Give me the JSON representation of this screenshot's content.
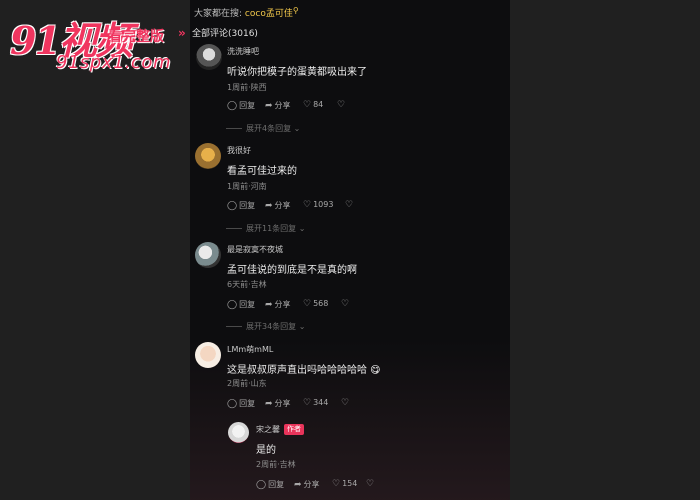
{
  "watermark": {
    "brand": "91视频",
    "see_full": "看完整版",
    "arrows": "»",
    "site": "91spx1.com"
  },
  "header": {
    "search_prefix": "大家都在搜:",
    "search_term": "coco孟可佳",
    "search_icon": "search-icon",
    "total_comments": "全部评论(3016)"
  },
  "comments": [
    {
      "user": "洗洗睡吧",
      "text": "听说你把模子的蛋黄都吸出来了",
      "meta": "1周前·陕西",
      "reply": "回复",
      "share": "分享",
      "likes": "84",
      "expand": "展开4条回复"
    },
    {
      "user": "我很好",
      "text": "看孟可佳过来的",
      "meta": "1周前·河南",
      "reply": "回复",
      "share": "分享",
      "likes": "1093",
      "expand": "展开11条回复"
    },
    {
      "user": "最是寂寞不夜城",
      "text": "孟可佳说的到底是不是真的啊",
      "meta": "6天前·吉林",
      "reply": "回复",
      "share": "分享",
      "likes": "568",
      "expand": "展开34条回复"
    },
    {
      "user": "LMm萌mML",
      "text": "这是叔叔原声直出吗哈哈哈哈哈 😋",
      "meta": "2周前·山东",
      "reply": "回复",
      "share": "分享",
      "likes": "344"
    }
  ],
  "reply_comment": {
    "user": "宋之馨",
    "badge": "作者",
    "text": "是的",
    "meta": "2周前·吉林",
    "reply": "回复",
    "share": "分享",
    "likes": "154"
  },
  "colors": {
    "accent": "#f0355f",
    "search_term": "#f2c84b",
    "author_badge": "#e8345a"
  }
}
